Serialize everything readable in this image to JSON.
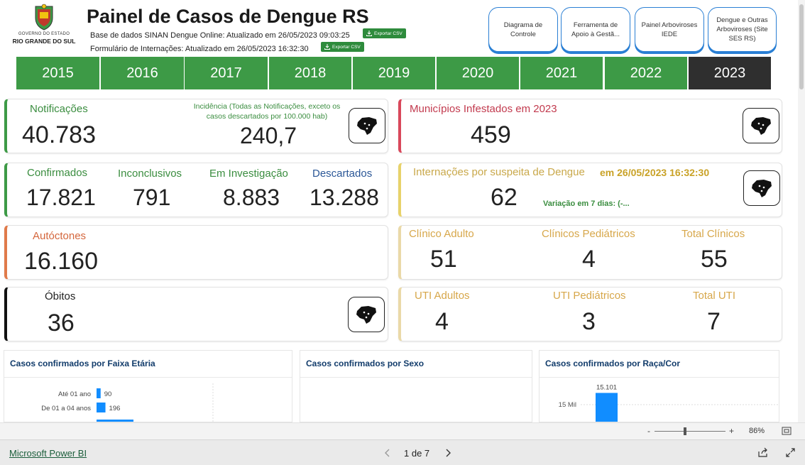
{
  "header": {
    "logo_line1": "GOVERNO DO ESTADO",
    "logo_line2": "RIO GRANDE DO SUL",
    "title": "Painel de Casos de Dengue RS",
    "sinan_text": "Base de dados SINAN Dengue Online: Atualizado em 26/05/2023 09:03:25",
    "intern_text": "Formulário de Internações: Atualizado em 26/05/2023 16:32:30",
    "export_label": "Exportar CSV"
  },
  "nav_buttons": [
    {
      "label": "Diagrama de Controle"
    },
    {
      "label": "Ferramenta de Apoio à Gestã..."
    },
    {
      "label": "Painel Arboviroses IEDE"
    },
    {
      "label": "Dengue e Outras Arboviroses (Site SES RS)"
    }
  ],
  "years": [
    "2015",
    "2016",
    "2017",
    "2018",
    "2019",
    "2020",
    "2021",
    "2022",
    "2023"
  ],
  "selected_year": "2023",
  "cards": {
    "notificacoes": {
      "label": "Notificações",
      "value": "40.783"
    },
    "incidencia": {
      "label": "Incidência (Todas as Notificações, exceto os casos descartados por 100.000 hab)",
      "value": "240,7"
    },
    "municipios": {
      "label": "Municípios Infestados em 2023",
      "value": "459"
    },
    "confirmados": {
      "label": "Confirmados",
      "value": "17.821"
    },
    "inconclusivos": {
      "label": "Inconclusivos",
      "value": "791"
    },
    "investigacao": {
      "label": "Em Investigação",
      "value": "8.883"
    },
    "descartados": {
      "label": "Descartados",
      "value": "13.288"
    },
    "internacoes": {
      "label": "Internações por suspeita de Dengue",
      "date": "em 26/05/2023 16:32:30",
      "value": "62",
      "variacao": "Variação em 7 dias: (-..."
    },
    "autoctones": {
      "label": "Autóctones",
      "value": "16.160"
    },
    "clinico_adulto": {
      "label": "Clínico Adulto",
      "value": "51"
    },
    "clinicos_ped": {
      "label": "Clínicos Pediátricos",
      "value": "4"
    },
    "total_clinicos": {
      "label": "Total Clínicos",
      "value": "55"
    },
    "obitos": {
      "label": "Óbitos",
      "value": "36"
    },
    "uti_adultos": {
      "label": "UTI Adultos",
      "value": "4"
    },
    "uti_ped": {
      "label": "UTI Pediátricos",
      "value": "3"
    },
    "total_uti": {
      "label": "Total UTI",
      "value": "7"
    }
  },
  "panels": {
    "faixa": {
      "title": "Casos confirmados por Faixa Etária"
    },
    "sexo": {
      "title": "Casos confirmados por Sexo"
    },
    "raca": {
      "title": "Casos confirmados por Raça/Cor"
    }
  },
  "chart_data": [
    {
      "type": "bar",
      "title": "Casos confirmados por Faixa Etária",
      "orientation": "horizontal",
      "categories": [
        "Até 01 ano",
        "De 01 a 04 anos"
      ],
      "values": [
        90,
        196
      ],
      "colors": [
        "#118dff"
      ]
    },
    {
      "type": "bar",
      "title": "Casos confirmados por Raça/Cor",
      "categories": [
        ""
      ],
      "values": [
        15101
      ],
      "data_labels": [
        "15.101"
      ],
      "y_tick_labels": [
        "15 Mil"
      ],
      "colors": [
        "#118dff"
      ]
    }
  ],
  "zoom": {
    "minus": "-",
    "plus": "+",
    "value": "86%"
  },
  "footer": {
    "brand": "Microsoft Power BI",
    "page": "1 de 7"
  },
  "colors": {
    "green": "#3d9a46",
    "dark": "#2f2f2f",
    "accent_blue": "#2a7fd4",
    "bar": "#118dff"
  },
  "icons": [
    "export-icon",
    "rs-map-icon",
    "chevron-left-icon",
    "chevron-right-icon",
    "share-icon",
    "fullscreen-icon",
    "fit-page-icon"
  ]
}
